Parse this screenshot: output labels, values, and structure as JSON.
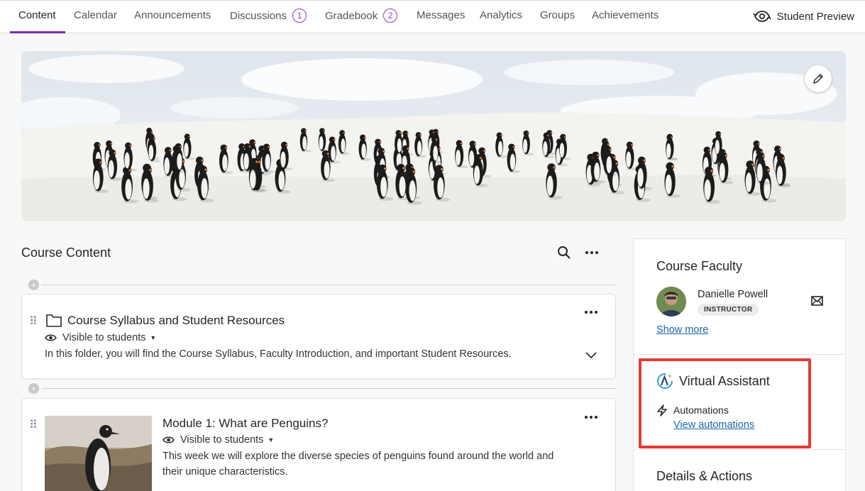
{
  "nav": {
    "tabs": [
      {
        "label": "Content"
      },
      {
        "label": "Calendar"
      },
      {
        "label": "Announcements"
      },
      {
        "label": "Discussions",
        "badge": "1"
      },
      {
        "label": "Gradebook",
        "badge": "2"
      },
      {
        "label": "Messages"
      },
      {
        "label": "Analytics"
      },
      {
        "label": "Groups"
      },
      {
        "label": "Achievements"
      }
    ],
    "student_preview": "Student Preview",
    "accent": "#7a2dae"
  },
  "course_content": {
    "title": "Course Content",
    "items": [
      {
        "title": "Course Syllabus and Student Resources",
        "visibility": "Visible to students",
        "description": "In this folder, you will find the Course Syllabus, Faculty Introduction, and important Student Resources.",
        "icon": "folder-icon"
      },
      {
        "title": "Module 1: What are Penguins?",
        "visibility": "Visible to students",
        "description_line1": "This week we will explore the diverse species of penguins found around the world and",
        "description_line2": "their unique characteristics.",
        "icon": "penguin-thumbnail"
      }
    ]
  },
  "sidebar": {
    "faculty": {
      "heading": "Course Faculty",
      "name": "Danielle Powell",
      "role": "INSTRUCTOR",
      "show_more": "Show more"
    },
    "assistant": {
      "heading": "Virtual Assistant",
      "automations_label": "Automations",
      "view_link": "View automations"
    },
    "details": {
      "heading": "Details & Actions"
    }
  }
}
